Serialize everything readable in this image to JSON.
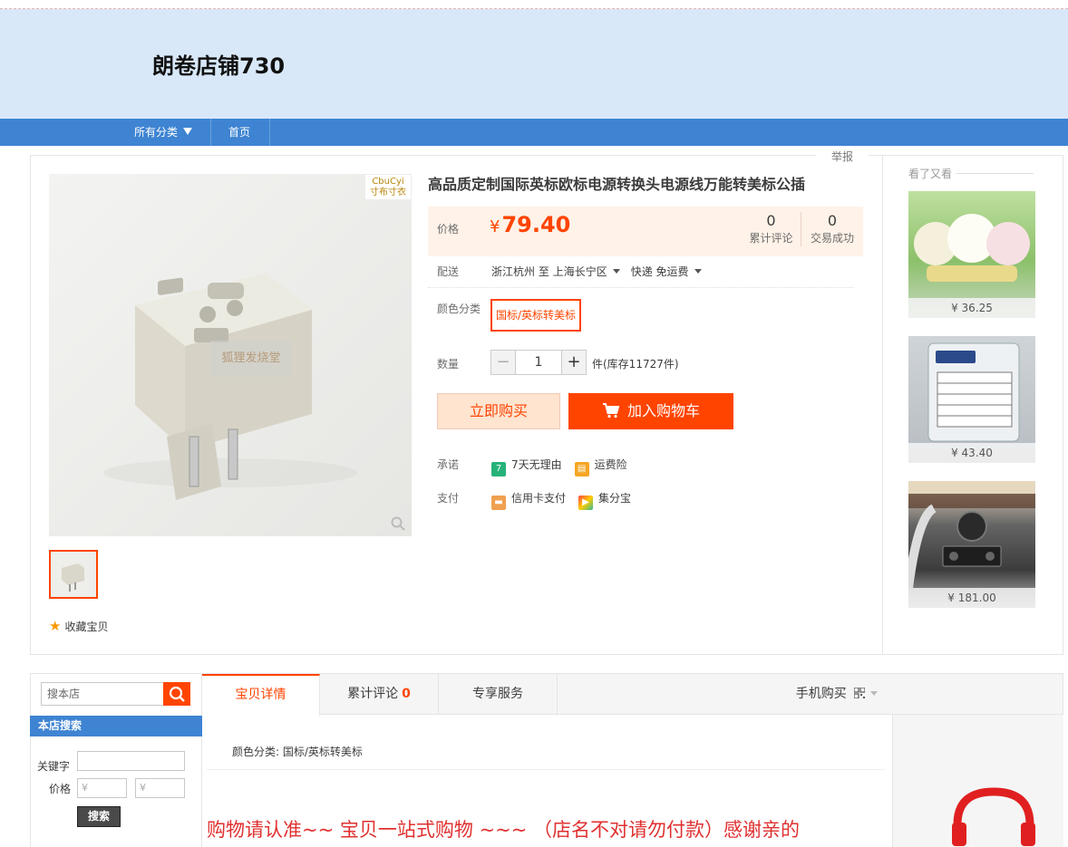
{
  "shop": {
    "name": "朗卷店铺730"
  },
  "nav": {
    "category": "所有分类",
    "home": "首页"
  },
  "report": "举报",
  "gallery": {
    "brand_mark": "CbuCyi\n寸布寸衣",
    "watermark": "狐狸发烧堂"
  },
  "favorite": "收藏宝贝",
  "product": {
    "title": "高品质定制国际英标欧标电源转换头电源线万能转美标公插",
    "price_label": "价格",
    "currency": "¥",
    "price": "79.40",
    "reviews_count": "0",
    "reviews_label": "累计评论",
    "trades_count": "0",
    "trades_label": "交易成功",
    "ship_label": "配送",
    "ship_from": "浙江杭州",
    "ship_to_word": "至",
    "ship_to": "上海长宁区",
    "ship_method": "快递 免运费",
    "color_label": "颜色分类",
    "color_option": "国标/英标转美标",
    "qty_label": "数量",
    "qty_minus": "−",
    "qty_value": "1",
    "qty_plus": "+",
    "stock_text": "件(库存11727件)",
    "buy_now": "立即购买",
    "add_cart": "加入购物车",
    "promise_label": "承诺",
    "promise_1": "7天无理由",
    "promise_2": "运费险",
    "pay_label": "支付",
    "pay_1": "信用卡支付",
    "pay_2": "集分宝"
  },
  "sidebar": {
    "title": "看了又看",
    "items": [
      {
        "price": "¥ 36.25"
      },
      {
        "price": "¥ 43.40"
      },
      {
        "price": "¥ 181.00"
      }
    ]
  },
  "shop_search": {
    "placeholder": "搜本店",
    "header": "本店搜索",
    "keyword_label": "关键字",
    "price_label": "价格",
    "min_placeholder": "¥",
    "max_placeholder": "¥",
    "submit": "搜索"
  },
  "tabs": {
    "detail": "宝贝详情",
    "reviews": "累计评论",
    "reviews_count": "0",
    "service": "专享服务",
    "mobile": "手机购买"
  },
  "detail": {
    "attr": "颜色分类: 国标/英标转美标",
    "desc": "购物请认准~~ 宝贝一站式购物 ~~~ （店名不对请勿付款）感谢亲的"
  },
  "colors": {
    "accent": "#ff4400",
    "nav": "#3e84d2",
    "banner": "#d9e8f9",
    "price_bg": "#fff2e8"
  }
}
